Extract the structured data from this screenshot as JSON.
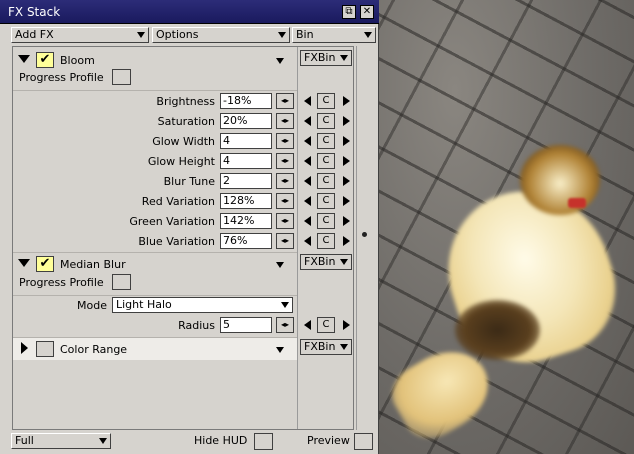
{
  "window": {
    "title": "FX Stack"
  },
  "toolbar": {
    "add_fx": "Add FX",
    "options": "Options",
    "bin": "Bin"
  },
  "fx_list": [
    {
      "name": "Bloom",
      "enabled": true,
      "expanded": true,
      "bin_label": "FXBin",
      "progress_profile_label": "Progress Profile",
      "params": [
        {
          "label": "Brightness",
          "value": "-18%"
        },
        {
          "label": "Saturation",
          "value": "20%"
        },
        {
          "label": "Glow Width",
          "value": "4"
        },
        {
          "label": "Glow Height",
          "value": "4"
        },
        {
          "label": "Blur Tune",
          "value": "2"
        },
        {
          "label": "Red Variation",
          "value": "128%"
        },
        {
          "label": "Green Variation",
          "value": "142%"
        },
        {
          "label": "Blue Variation",
          "value": "76%"
        }
      ]
    },
    {
      "name": "Median Blur",
      "enabled": true,
      "expanded": true,
      "bin_label": "FXBin",
      "progress_profile_label": "Progress Profile",
      "mode_label": "Mode",
      "mode_value": "Light Halo",
      "params": [
        {
          "label": "Radius",
          "value": "5"
        }
      ]
    },
    {
      "name": "Color Range",
      "enabled": false,
      "expanded": false,
      "bin_label": "FXBin"
    }
  ],
  "param_buttons": {
    "spin": "◂▸",
    "reset": "C"
  },
  "bottom": {
    "view_mode": "Full",
    "hide_hud": "Hide HUD",
    "preview": "Preview"
  },
  "titlebar_buttons": {
    "restore": "⧉",
    "close": "✕"
  },
  "colors": {
    "titlebar": "#1a1a5e",
    "checkbox_on": "#ffff99",
    "panel": "#d6d3ce"
  }
}
